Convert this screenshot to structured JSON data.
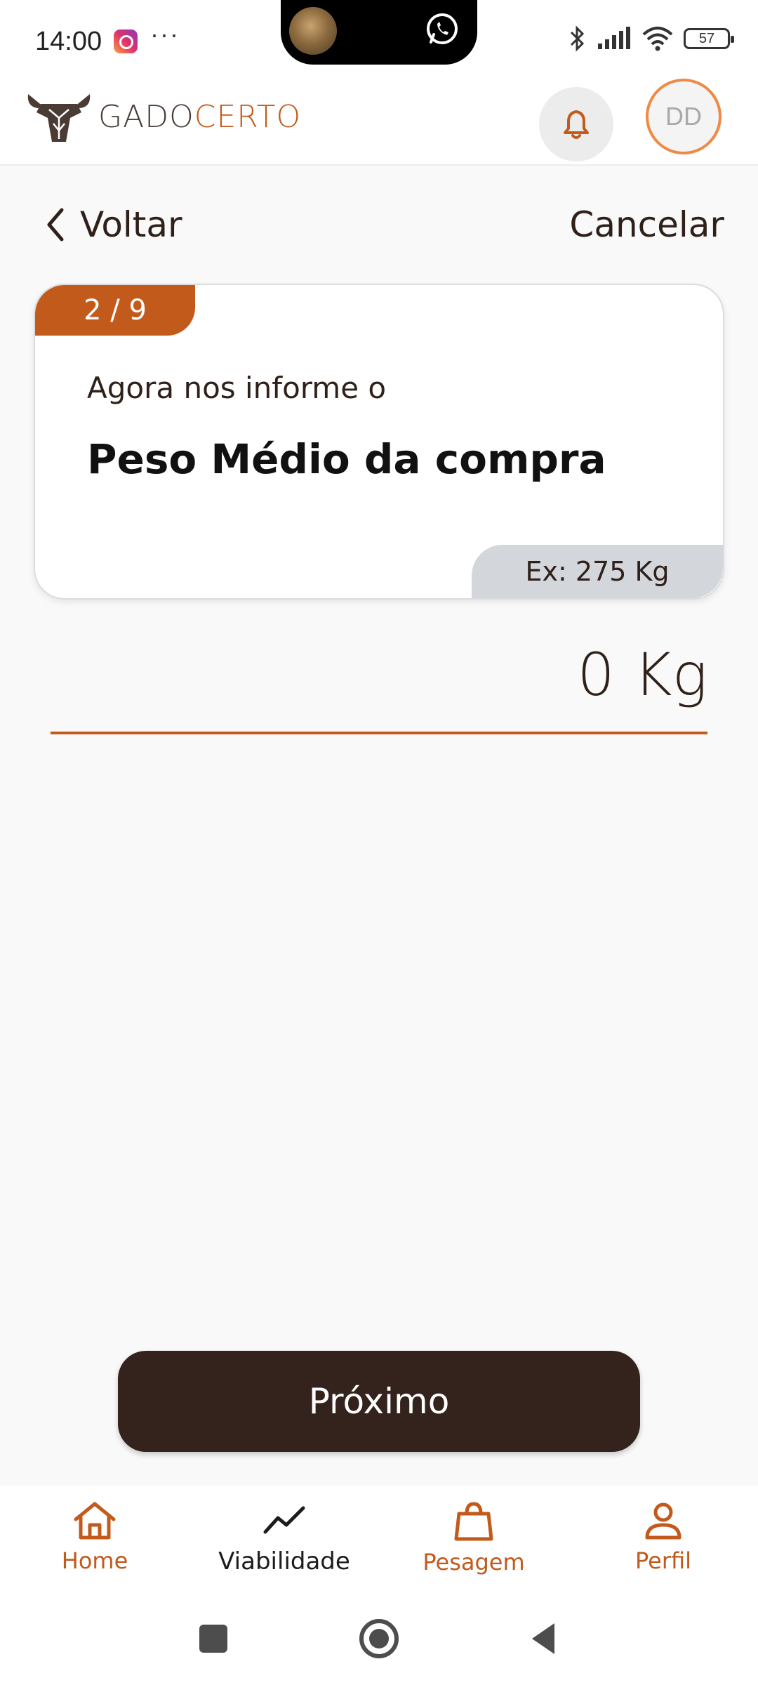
{
  "status_bar": {
    "time": "14:00",
    "overflow": "···",
    "battery": "57",
    "icons": [
      "instagram-icon",
      "whatsapp-icon",
      "bluetooth-icon",
      "signal-icon",
      "wifi-icon",
      "battery-icon"
    ]
  },
  "header": {
    "brand_part1": "GADO",
    "brand_part2": "CERTO",
    "avatar_initials": "DD"
  },
  "nav": {
    "back_label": "Voltar",
    "cancel_label": "Cancelar"
  },
  "card": {
    "step": "2 / 9",
    "prompt": "Agora nos informe o",
    "title": "Peso Médio da compra",
    "example": "Ex: 275 Kg"
  },
  "weight": {
    "value": "0",
    "unit": "Kg",
    "display": "0 Kg"
  },
  "actions": {
    "next_label": "Próximo"
  },
  "bottom_nav": {
    "items": [
      {
        "label": "Home",
        "icon": "home-icon",
        "active": false
      },
      {
        "label": "Viabilidade",
        "icon": "trend-icon",
        "active": true
      },
      {
        "label": "Pesagem",
        "icon": "bag-icon",
        "active": false
      },
      {
        "label": "Perfil",
        "icon": "person-icon",
        "active": false
      }
    ]
  },
  "colors": {
    "accent": "#c25a1b",
    "dark": "#33231c",
    "avatar_ring": "#ef8a45",
    "background": "#f9f9f9",
    "example_badge": "#d3d6da"
  }
}
